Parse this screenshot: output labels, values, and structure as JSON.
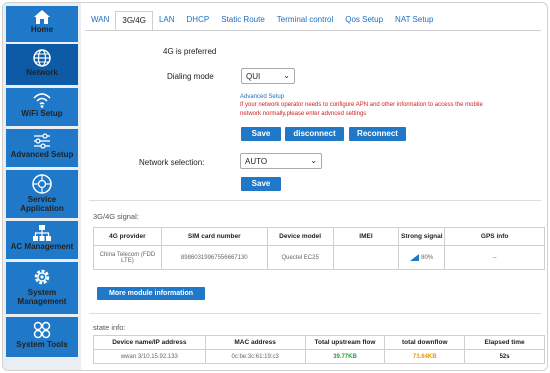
{
  "sidebar": {
    "items": [
      {
        "label": "Home",
        "icon": "home-icon"
      },
      {
        "label": "Network",
        "icon": "globe-icon"
      },
      {
        "label": "WiFi Setup",
        "icon": "wifi-icon"
      },
      {
        "label": "Advanced Setup",
        "icon": "sliders-icon"
      },
      {
        "label": "Service\nApplication",
        "icon": "service-icon"
      },
      {
        "label": "AC Management",
        "icon": "network-tree-icon"
      },
      {
        "label": "System\nManagement",
        "icon": "gear-icon"
      },
      {
        "label": "System Tools",
        "icon": "tools-icon"
      }
    ]
  },
  "tabs": [
    "WAN",
    "3G/4G",
    "LAN",
    "DHCP",
    "Static Route",
    "Terminal control",
    "Qos Setup",
    "NAT Setup"
  ],
  "active_tab": "3G/4G",
  "form": {
    "preferred_text": "4G is preferred",
    "dialing_mode_label": "Dialing mode",
    "dialing_mode_value": "QUI",
    "advanced_setup_link": "Advanced Setup",
    "warning_line1": "If your network operator needs to configure APN and other information to access the mobile",
    "warning_line2": "network normally,please enter advnced settings",
    "save_label": "Save",
    "disconnect_label": "disconnect",
    "reconnect_label": "Reconnect",
    "network_selection_label": "Network selection:",
    "network_selection_value": "AUTO",
    "save2_label": "Save"
  },
  "signal": {
    "title": "3G/4G signal:",
    "headers": [
      "4G provider",
      "SIM card number",
      "Device model",
      "IMEI",
      "Strong signal",
      "GPS info"
    ],
    "row": {
      "provider": "China Telecom (FDD LTE)",
      "sim": "89860319967556667130",
      "model": "Quectel EC25",
      "imei": "",
      "strength": "80%",
      "gps": "--"
    },
    "more_button": "More module information"
  },
  "state": {
    "title": "state info:",
    "headers": [
      "Device name/IP address",
      "MAC address",
      "Total upstream flow",
      "total downflow",
      "Elapsed time"
    ],
    "row": {
      "device": "wwan 3/10.15.92.133",
      "mac": "0c:be:3c:61:19:c3",
      "up": "39.77KB",
      "down": "73.64KB",
      "elapsed": "52s"
    }
  },
  "colors": {
    "accent": "#1f78c8",
    "warning": "#d02020",
    "upflow": "#2a9a3a",
    "downflow": "#e59a00"
  }
}
